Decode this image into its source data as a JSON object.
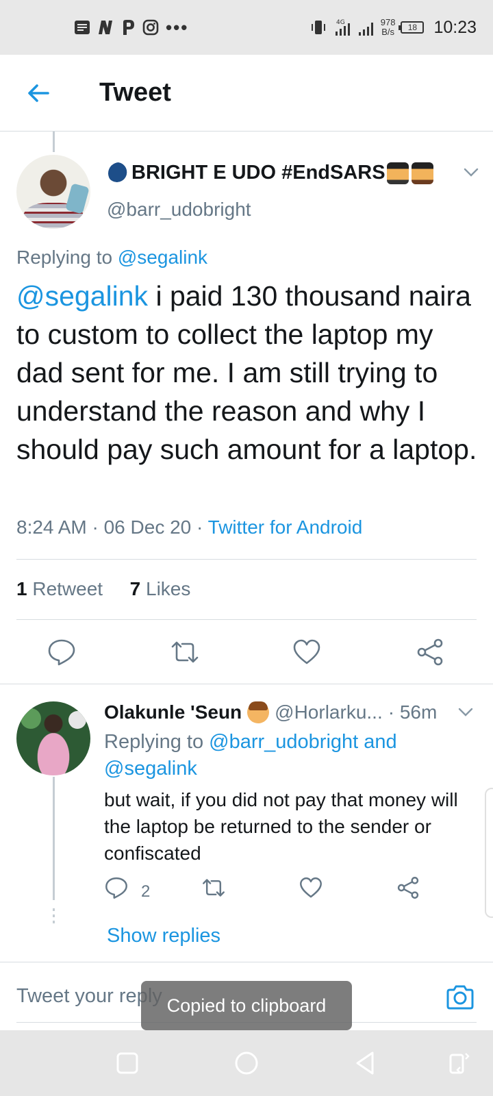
{
  "status_bar": {
    "time": "10:23",
    "net_speed_value": "978",
    "net_speed_unit": "B/s",
    "battery": "18",
    "network": "4G",
    "left_icons": [
      "notes-icon",
      "n-app-icon",
      "p-app-icon",
      "instagram-icon",
      "more-dots-icon"
    ]
  },
  "header": {
    "title": "Tweet",
    "back_icon": "arrow-left-icon"
  },
  "tweet": {
    "display_name": "BRIGHT E UDO #EndSARS",
    "handle": "@barr_udobright",
    "replying_label": "Replying to",
    "replying_handle": "@segalink",
    "mention": "@segalink",
    "text": " i paid 130 thousand naira to custom to collect the laptop my dad sent for me. I am still trying to understand the reason and why I should pay such amount for a laptop.",
    "timestamp": "8:24 AM · 06 Dec 20 · ",
    "source": "Twitter for Android",
    "retweet_count": "1",
    "retweet_label": "Retweet",
    "like_count": "7",
    "like_label": "Likes"
  },
  "reply": {
    "name": "Olakunle 'Seun",
    "handle": "@Horlarku...",
    "time": "· 56m",
    "replying_label": "Replying to ",
    "replying_handles": "@barr_udobright and @segalink",
    "text": "but wait, if you did not pay that money will the laptop be returned to the sender or confiscated",
    "reply_count": "2",
    "show_replies": "Show replies"
  },
  "compose": {
    "placeholder": "Tweet your reply"
  },
  "toast": {
    "text": "Copied to clipboard"
  },
  "colors": {
    "accent": "#1b95e0",
    "secondary_text": "#657786",
    "primary_text": "#14171a",
    "divider": "#d7dce0"
  }
}
